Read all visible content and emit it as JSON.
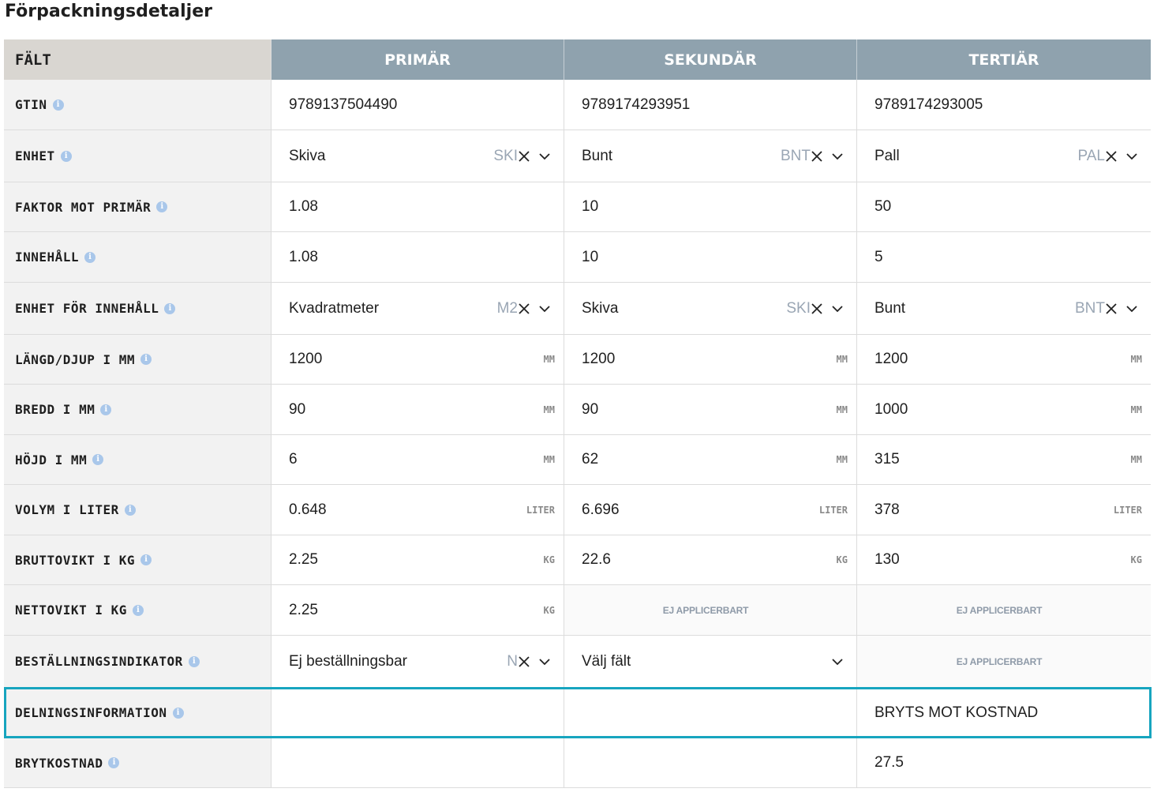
{
  "page": {
    "title": "Förpackningsdetaljer"
  },
  "header": {
    "field": "FÄLT",
    "primary": "PRIMÄR",
    "secondary": "SEKUNDÄR",
    "tertiary": "TERTIÄR"
  },
  "rows": {
    "gtin": {
      "label": "GTIN",
      "p": "9789137504490",
      "s": "9789174293951",
      "t": "9789174293005"
    },
    "enhet": {
      "label": "ENHET",
      "p": "Skiva",
      "p_code": "SKI",
      "s": "Bunt",
      "s_code": "BNT",
      "t": "Pall",
      "t_code": "PAL"
    },
    "faktor": {
      "label": "FAKTOR MOT PRIMÄR",
      "p": "1.08",
      "s": "10",
      "t": "50"
    },
    "innehall": {
      "label": "INNEHÅLL",
      "p": "1.08",
      "s": "10",
      "t": "5"
    },
    "enhet_innehall": {
      "label": "ENHET FÖR INNEHÅLL",
      "p": "Kvadratmeter",
      "p_code": "M2",
      "s": "Skiva",
      "s_code": "SKI",
      "t": "Bunt",
      "t_code": "BNT"
    },
    "langd": {
      "label": "LÄNGD/DJUP I MM",
      "p": "1200",
      "s": "1200",
      "t": "1200",
      "unit": "MM"
    },
    "bredd": {
      "label": "BREDD I MM",
      "p": "90",
      "s": "90",
      "t": "1000",
      "unit": "MM"
    },
    "hojd": {
      "label": "HÖJD I MM",
      "p": "6",
      "s": "62",
      "t": "315",
      "unit": "MM"
    },
    "volym": {
      "label": "VOLYM I LITER",
      "p": "0.648",
      "s": "6.696",
      "t": "378",
      "unit": "LITER"
    },
    "brutto": {
      "label": "BRUTTOVIKT I KG",
      "p": "2.25",
      "s": "22.6",
      "t": "130",
      "unit": "KG"
    },
    "netto": {
      "label": "NETTOVIKT I KG",
      "p": "2.25",
      "s_na": "EJ APPLICERBART",
      "t_na": "EJ APPLICERBART",
      "unit": "KG"
    },
    "bestallning": {
      "label": "BESTÄLLNINGSINDIKATOR",
      "p": "Ej beställningsbar",
      "p_code": "N",
      "s_placeholder": "Välj fält",
      "t_na": "EJ APPLICERBART"
    },
    "delning": {
      "label": "DELNINGSINFORMATION",
      "p": "",
      "s": "",
      "t": "BRYTS MOT KOSTNAD"
    },
    "brytkostnad": {
      "label": "BRYTKOSTNAD",
      "p": "",
      "s": "",
      "t": "27.5"
    }
  },
  "icons": {
    "info": "info-icon",
    "clear": "x-icon",
    "dropdown": "chevron-down-icon"
  },
  "colors": {
    "header_bg": "#8fa2ae",
    "field_header_bg": "#d9d6d1",
    "field_bg": "#f2f2f2",
    "highlight": "#17a5bf",
    "info": "#a9c7ea"
  }
}
